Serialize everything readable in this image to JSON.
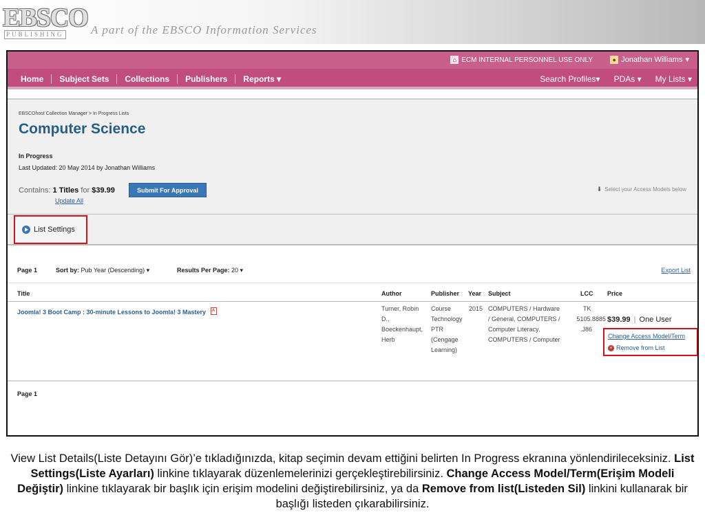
{
  "banner": {
    "logo_top": "EBSCO",
    "logo_bottom": "PUBLISHING",
    "tagline": "A part of the EBSCO Information Services"
  },
  "topbar": {
    "ecm_text": "ECM INTERNAL PERSONNEL USE ONLY",
    "user_name": "Jonathan Williams"
  },
  "nav": {
    "items": [
      "Home",
      "Subject Sets",
      "Collections",
      "Publishers",
      "Reports ▾"
    ],
    "right": [
      "Search Profiles▾",
      "PDAs ▾",
      "My Lists ▾"
    ]
  },
  "header": {
    "breadcrumb": "EBSCOhost Collection Manager  >  In Progress Lists",
    "title": "Computer Science",
    "status": "In Progress",
    "last_updated": "Last Updated: 20 May 2014 by Jonathan Williams",
    "contains_label": "Contains:",
    "titles_count": "1 Titles",
    "for_label": "for",
    "total_price": "$39.99",
    "submit_label": "Submit For Approval",
    "update_all": "Update All",
    "access_hint": "Select your Access Models below"
  },
  "settings": {
    "label": "List Settings"
  },
  "toolbar": {
    "page": "Page 1",
    "sort_label": "Sort by:",
    "sort_value": "Pub Year (Descending) ▾",
    "results_label": "Results Per Page:",
    "results_value": "20 ▾",
    "export": "Export List"
  },
  "table": {
    "headers": [
      "Title",
      "Author",
      "Publisher",
      "Year",
      "Subject",
      "LCC",
      "Price"
    ],
    "rows": [
      {
        "title": "Joomla! 3 Boot Camp : 30-minute Lessons to Joomla! 3 Mastery",
        "author": [
          "Turner, Robin",
          "D.,",
          "Boeckenhaupt,",
          "Herb"
        ],
        "publisher": [
          "Course",
          "Technology",
          "PTR",
          "(Cengage",
          "Learning)"
        ],
        "year": "2015",
        "subject": [
          "COMPUTERS / Hardware",
          "/ General, COMPUTERS /",
          "Computer Literacy,",
          "COMPUTERS / Computer"
        ],
        "lcc": [
          "TK",
          "5105.8885",
          ".J86"
        ],
        "price": "$39.99",
        "license": "One User",
        "change_link": "Change Access Model/Term",
        "remove_link": "Remove from List"
      }
    ]
  },
  "footer": {
    "page": "Page 1"
  },
  "caption": {
    "part1": "View List Details(Liste Detayını Gör)’e tıkladığınızda, kitap seçimin devam ettiğini belirten In Progress ekranına yönlendirileceksiniz. ",
    "bold1": "List Settings(Liste Ayarları)",
    "part2": " linkine tıklayarak düzenlemelerinizi gerçekleştirebilirsiniz. ",
    "bold2": "Change Access Model/Term(Erişim Modeli Değiştir)",
    "part3": " linkine tıklayarak bir başlık için erişim modelini değiştirebilirsiniz, ya da  ",
    "bold3": "Remove from list(Listeden Sil)",
    "part4": " linkini kullanarak bir başlığı listeden çıkarabilirsiniz."
  }
}
